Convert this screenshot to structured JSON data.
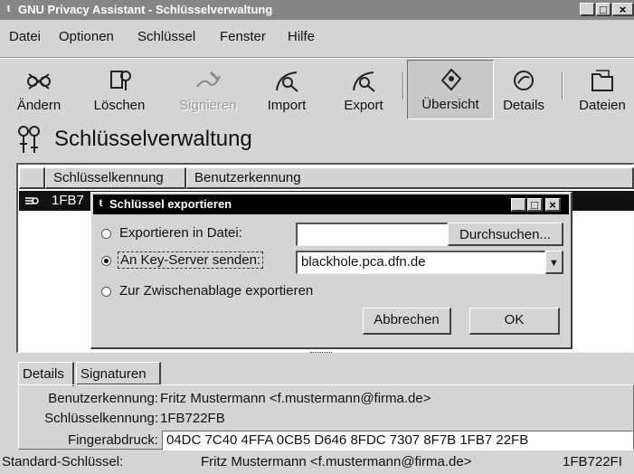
{
  "window": {
    "title": "GNU Privacy Assistant - Schlüsselverwaltung",
    "controls": [
      "_",
      "□",
      "×"
    ]
  },
  "menu": [
    "Datei",
    "Optionen",
    "Schlüssel",
    "Fenster",
    "Hilfe"
  ],
  "toolbar": [
    {
      "label": "Ändern",
      "icon": "edit-keys-icon",
      "enabled": true
    },
    {
      "label": "Löschen",
      "icon": "delete-key-icon",
      "enabled": true
    },
    {
      "label": "Signieren",
      "icon": "sign-key-icon",
      "enabled": false
    },
    {
      "label": "Import",
      "icon": "import-key-icon",
      "enabled": true
    },
    {
      "label": "Export",
      "icon": "export-key-icon",
      "enabled": true
    },
    {
      "label": "Übersicht",
      "icon": "overview-icon",
      "enabled": true,
      "active": true
    },
    {
      "label": "Details",
      "icon": "details-icon",
      "enabled": true
    },
    {
      "label": "Dateien",
      "icon": "files-icon",
      "enabled": true
    }
  ],
  "heading": "Schlüsselverwaltung",
  "list": {
    "columns": [
      "Schlüsselkennung",
      "Benutzerkennung"
    ],
    "rows": [
      {
        "key_id": "1FB7",
        "selected": true
      }
    ]
  },
  "dialog": {
    "title": "Schlüssel exportieren",
    "options": [
      {
        "label": "Exportieren in Datei:",
        "checked": false
      },
      {
        "label": "An Key-Server senden:",
        "checked": true
      },
      {
        "label": "Zur Zwischenablage exportieren",
        "checked": false
      }
    ],
    "file_value": "",
    "browse_label": "Durchsuchen...",
    "keyserver_value": "blackhole.pca.dfn.de",
    "cancel_label": "Abbrechen",
    "ok_label": "OK"
  },
  "tabs": [
    "Details",
    "Signaturen"
  ],
  "details": {
    "user_id_label": "Benutzerkennung:",
    "user_id": "Fritz Mustermann <f.mustermann@firma.de>",
    "key_id_label": "Schlüsselkennung:",
    "key_id": "1FB722FB",
    "fingerprint_label": "Fingerabdruck:",
    "fingerprint": "04DC 7C40 4FFA 0CB5 D646  8FDC 7307 8F7B 1FB7 22FB"
  },
  "status": {
    "label": "Standard-Schlüssel:",
    "user": "Fritz Mustermann <f.mustermann@firma.de>",
    "key": "1FB722FI"
  }
}
